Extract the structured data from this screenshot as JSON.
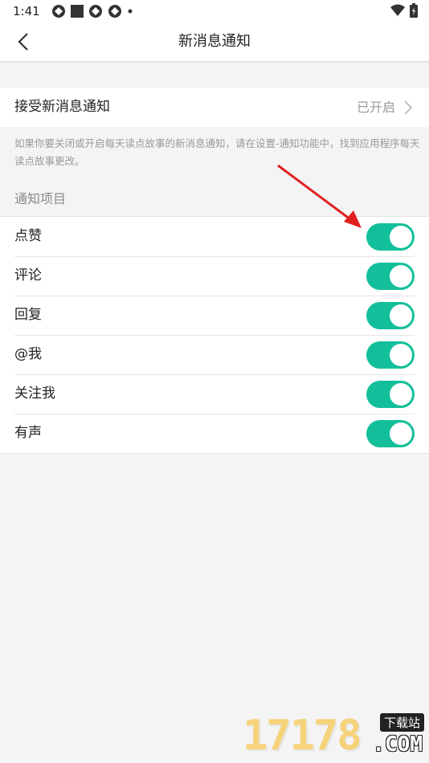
{
  "status_bar": {
    "time": "1:41"
  },
  "nav": {
    "title": "新消息通知"
  },
  "main_setting": {
    "label": "接受新消息通知",
    "value": "已开启"
  },
  "hint": "如果你要关闭或开启每天读点故事的新消息通知，请在设置-通知功能中，找到应用程序每天读点故事更改。",
  "section_title": "通知项目",
  "items": [
    {
      "label": "点赞",
      "enabled": true
    },
    {
      "label": "评论",
      "enabled": true
    },
    {
      "label": "回复",
      "enabled": true
    },
    {
      "label": "@我",
      "enabled": true
    },
    {
      "label": "关注我",
      "enabled": true
    },
    {
      "label": "有声",
      "enabled": true
    }
  ],
  "colors": {
    "switch_on": "#13bf9a",
    "annotation_arrow": "#e02020"
  },
  "watermark": {
    "digits": "17178",
    "badge": "下载站",
    "domain": ".COM"
  }
}
